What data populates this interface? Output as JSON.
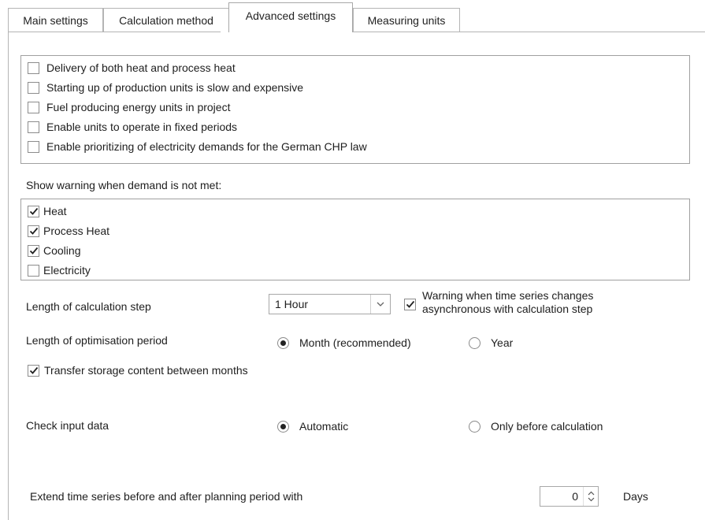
{
  "tabs": [
    {
      "label": "Main settings"
    },
    {
      "label": "Calculation method"
    },
    {
      "label": "Advanced settings"
    },
    {
      "label": "Measuring units"
    }
  ],
  "active_tab": "Advanced settings",
  "options": [
    {
      "label": "Delivery of both heat and process heat",
      "checked": false
    },
    {
      "label": "Starting up of production units is slow and expensive",
      "checked": false
    },
    {
      "label": "Fuel producing energy units in project",
      "checked": false
    },
    {
      "label": "Enable units to operate in fixed periods",
      "checked": false
    },
    {
      "label": "Enable prioritizing of electricity demands for the German CHP law",
      "checked": false
    }
  ],
  "warning_section": {
    "title": "Show warning when demand is not met:",
    "items": [
      {
        "label": "Heat",
        "checked": true
      },
      {
        "label": "Process Heat",
        "checked": true
      },
      {
        "label": "Cooling",
        "checked": true
      },
      {
        "label": "Electricity",
        "checked": false
      }
    ]
  },
  "calc_step": {
    "label": "Length of calculation step",
    "value": "1 Hour",
    "warning_label_line1": "Warning when time series changes",
    "warning_label_line2": "asynchronous with calculation step",
    "warning_checked": true
  },
  "optimisation": {
    "label": "Length of optimisation period",
    "option1": "Month (recommended)",
    "option2": "Year",
    "selected": "Month (recommended)"
  },
  "transfer": {
    "label": "Transfer storage content between months",
    "checked": true
  },
  "check_input": {
    "label": "Check input data",
    "option1": "Automatic",
    "option2": "Only before calculation",
    "selected": "Automatic"
  },
  "extend": {
    "label": "Extend time series before and after planning period with",
    "value": "0",
    "unit": "Days"
  }
}
